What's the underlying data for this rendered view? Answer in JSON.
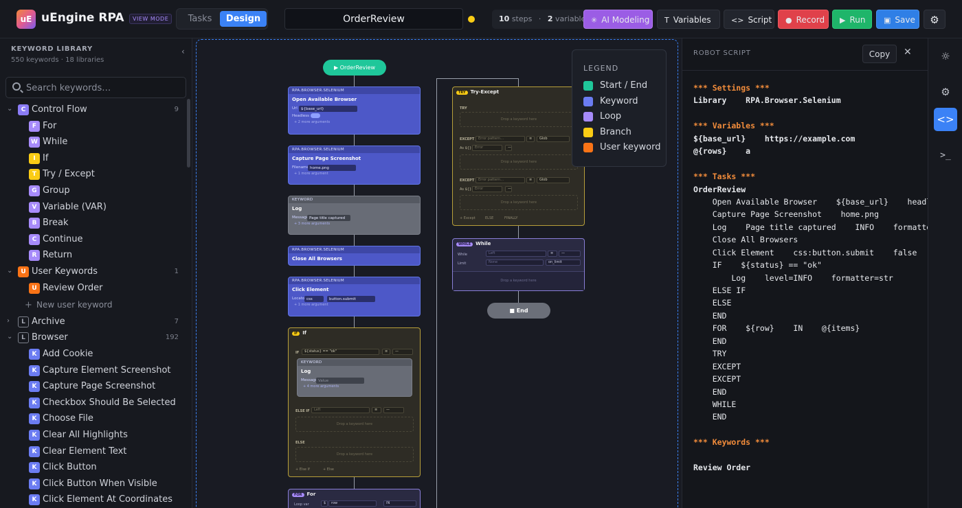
{
  "header": {
    "logo": "uE",
    "app_name": "uEngine RPA",
    "view_mode": "VIEW MODE",
    "tabs": [
      "Tasks",
      "Design"
    ],
    "title": "OrderReview",
    "steps_count": "10",
    "steps_label": "steps",
    "vars_count": "2",
    "vars_label": "variables",
    "buttons": {
      "ai": "AI Modeling",
      "variables": "Variables",
      "script": "Script",
      "record": "Record",
      "run": "Run",
      "save": "Save"
    },
    "colors": {
      "ai": "#a855f7",
      "record": "#ef4444",
      "run": "#22c55e",
      "save": "#3b82f6",
      "status": "#facc15"
    }
  },
  "sidebar": {
    "title": "KEYWORD LIBRARY",
    "subtitle": "550 keywords · 18 libraries",
    "search_placeholder": "Search keywords…",
    "groups": [
      {
        "name": "Control Flow",
        "badge": "C",
        "count": "9",
        "items": [
          "For",
          "While",
          "If",
          "Try / Except",
          "Group",
          "Variable (VAR)",
          "Break",
          "Continue",
          "Return"
        ]
      },
      {
        "name": "User Keywords",
        "badge": "U",
        "count": "1",
        "items": [
          "Review Order"
        ],
        "new_label": "New user keyword"
      },
      {
        "name": "Archive",
        "badge": "L",
        "count": "7"
      },
      {
        "name": "Browser",
        "badge": "L",
        "count": "192",
        "items": [
          "Add Cookie",
          "Capture Element Screenshot",
          "Capture Page Screenshot",
          "Checkbox Should Be Selected",
          "Choose File",
          "Clear All Highlights",
          "Clear Element Text",
          "Click Button",
          "Click Button When Visible",
          "Click Element At Coordinates"
        ]
      }
    ],
    "item_badges": [
      "F",
      "W",
      "I",
      "T",
      "G",
      "V",
      "B",
      "C",
      "R"
    ]
  },
  "canvas": {
    "start": "OrderReview",
    "end": "End",
    "nodes": [
      {
        "lib": "RPA.BROWSER.SELENIUM",
        "name": "Open Available Browser",
        "field": "Url",
        "value": "${base_url}",
        "extra": "Headless",
        "more": "+ 2 more arguments"
      },
      {
        "lib": "RPA.BROWSER.SELENIUM",
        "name": "Capture Page Screenshot",
        "field": "Filename",
        "value": "home.png",
        "more": "+ 1 more argument"
      },
      {
        "lib": "KEYWORD",
        "name": "Log",
        "field": "Message",
        "value": "Page title captured",
        "more": "+ 3 more arguments"
      },
      {
        "lib": "RPA.BROWSER.SELENIUM",
        "name": "Close All Browsers"
      },
      {
        "lib": "RPA.BROWSER.SELENIUM",
        "name": "Click Element",
        "field": "Locator",
        "prefix": "css",
        "value": "button.submit",
        "more": "+ 1 more argument"
      }
    ],
    "if_block": {
      "tag": "IF",
      "name": "If",
      "cond_label": "IF",
      "cond": "${status} == \"ok\"",
      "inner_lib": "KEYWORD",
      "inner_name": "Log",
      "inner_field": "Message",
      "inner_ph": "Value",
      "inner_more": "+ 4 more arguments",
      "elseif": "ELSE IF",
      "elseif_ph": "Left",
      "else": "ELSE",
      "drop": "Drop a keyword here",
      "add_else_if": "+ Else If",
      "add_else": "+ Else"
    },
    "for_block": {
      "tag": "FOR",
      "name": "For",
      "field": "Loop var",
      "value": "row",
      "op": "IN"
    },
    "try_block": {
      "tag": "TRY",
      "name": "Try-Except",
      "try_label": "TRY",
      "except_label": "EXCEPT",
      "except1_ph": "Error pattern…",
      "except2_ph": "Error pattern…",
      "as1": "As ${}",
      "as1_ph": "Error",
      "as2": "As ${}",
      "as2_ph": "Error",
      "type": "Glob",
      "drop": "Drop a keyword here",
      "add_except": "+ Except",
      "add_else": "ELSE",
      "add_finally": "FINALLY"
    },
    "while_block": {
      "tag": "WHILE",
      "name": "While",
      "while_label": "While",
      "while_ph": "Left",
      "limit_label": "Limit",
      "limit_ph": "None",
      "on_limit": "on_limit",
      "drop": "Drop a keyword here"
    },
    "legend": {
      "title": "LEGEND",
      "items": [
        {
          "label": "Start / End",
          "color": "#1fc79a"
        },
        {
          "label": "Keyword",
          "color": "#6b7cf2"
        },
        {
          "label": "Loop",
          "color": "#a78bfa"
        },
        {
          "label": "Branch",
          "color": "#facc15"
        },
        {
          "label": "User keyword",
          "color": "#f97316"
        }
      ]
    }
  },
  "script_panel": {
    "title": "ROBOT SCRIPT",
    "copy": "Copy",
    "lines": [
      {
        "t": "*** Settings ***",
        "c": "s"
      },
      {
        "t": "Library    RPA.Browser.Selenium",
        "c": "b"
      },
      {
        "t": "",
        "c": ""
      },
      {
        "t": "*** Variables ***",
        "c": "s"
      },
      {
        "t": "${base_url}    https://example.com",
        "c": "b"
      },
      {
        "t": "@{rows}    a",
        "c": "b"
      },
      {
        "t": "",
        "c": ""
      },
      {
        "t": "*** Tasks ***",
        "c": "s"
      },
      {
        "t": "OrderReview",
        "c": "b"
      },
      {
        "t": "    Open Available Browser    ${base_url}    headle",
        "c": ""
      },
      {
        "t": "    Capture Page Screenshot    home.png",
        "c": ""
      },
      {
        "t": "    Log    Page title captured    INFO    formatter",
        "c": ""
      },
      {
        "t": "    Close All Browsers",
        "c": ""
      },
      {
        "t": "    Click Element    css:button.submit    false",
        "c": ""
      },
      {
        "t": "    IF    ${status} == \"ok\"",
        "c": ""
      },
      {
        "t": "        Log    level=INFO    formatter=str",
        "c": ""
      },
      {
        "t": "    ELSE IF",
        "c": ""
      },
      {
        "t": "    ELSE",
        "c": ""
      },
      {
        "t": "    END",
        "c": ""
      },
      {
        "t": "    FOR    ${row}    IN    @{items}",
        "c": ""
      },
      {
        "t": "    END",
        "c": ""
      },
      {
        "t": "    TRY",
        "c": ""
      },
      {
        "t": "    EXCEPT",
        "c": ""
      },
      {
        "t": "    EXCEPT",
        "c": ""
      },
      {
        "t": "    END",
        "c": ""
      },
      {
        "t": "    WHILE",
        "c": ""
      },
      {
        "t": "    END",
        "c": ""
      },
      {
        "t": "",
        "c": ""
      },
      {
        "t": "*** Keywords ***",
        "c": "s"
      },
      {
        "t": "",
        "c": ""
      },
      {
        "t": "Review Order",
        "c": "b"
      }
    ]
  }
}
